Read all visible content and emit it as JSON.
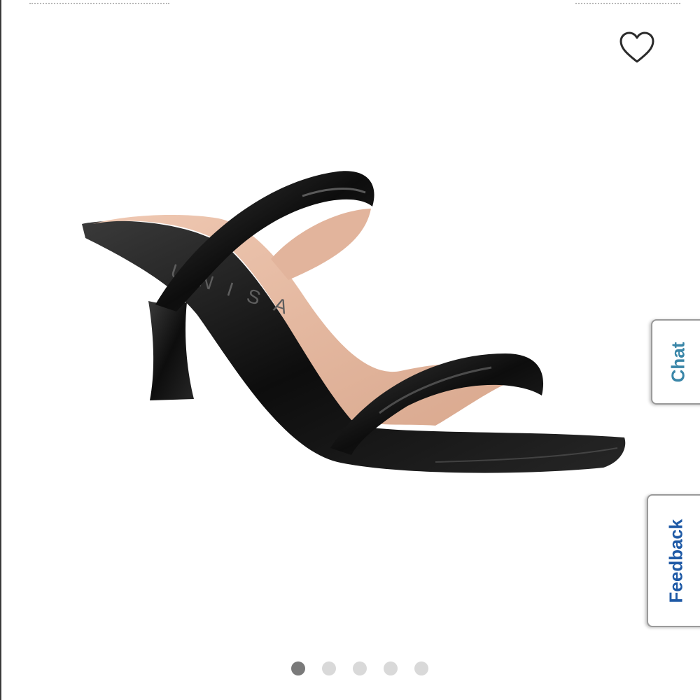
{
  "header": {
    "favorite_icon": "heart-outline-icon"
  },
  "product": {
    "image_alt": "sandal-product-image",
    "insole_brand": "UNISA"
  },
  "side_tabs": {
    "chat_label": "Chat",
    "feedback_label": "Feedback"
  },
  "carousel": {
    "total_images": 5,
    "active_index": 1
  },
  "colors": {
    "chat_text": "#3a86a8",
    "feedback_text": "#1f5aa6",
    "active_dot": "#7a7a7a",
    "inactive_dot": "#d9d9d9"
  }
}
